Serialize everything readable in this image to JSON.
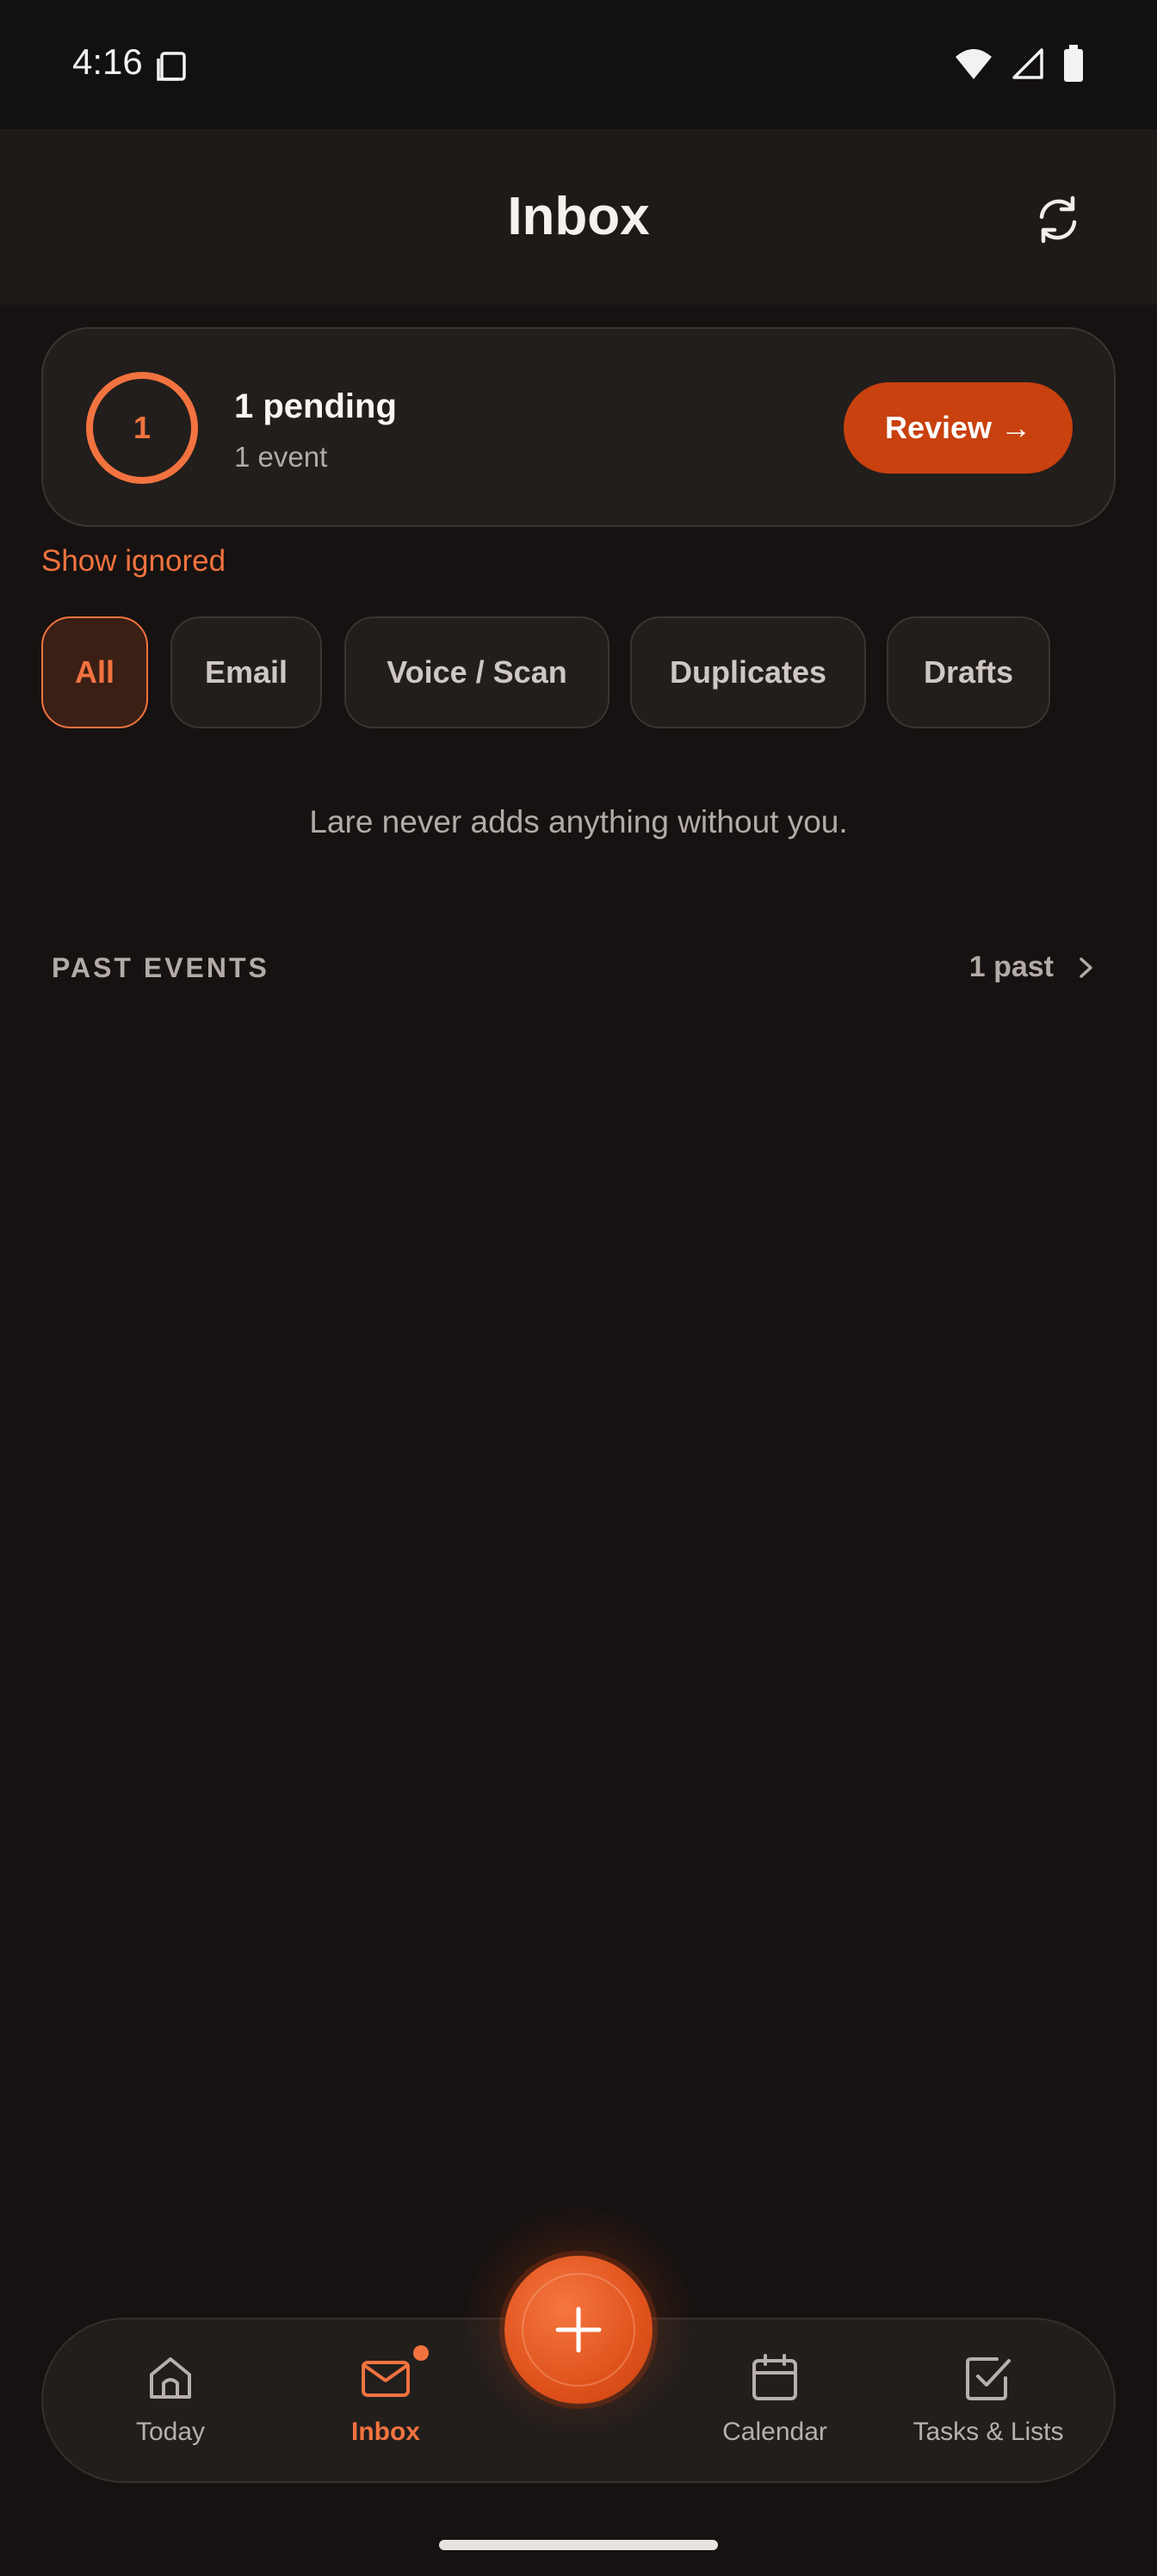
{
  "status_bar": {
    "time": "4:16"
  },
  "header": {
    "title": "Inbox"
  },
  "pending": {
    "count": "1",
    "title": "1 pending",
    "subtitle": "1 event",
    "review_label": "Review →"
  },
  "show_ignored_label": "Show ignored",
  "filters": [
    {
      "label": "All",
      "selected": true
    },
    {
      "label": "Email",
      "selected": false
    },
    {
      "label": "Voice / Scan",
      "selected": false
    },
    {
      "label": "Duplicates",
      "selected": false
    },
    {
      "label": "Drafts",
      "selected": false
    }
  ],
  "notice": "Lare never adds anything without you.",
  "past_events": {
    "label": "PAST EVENTS",
    "count_label": "1 past"
  },
  "nav": {
    "items": [
      {
        "label": "Today",
        "icon": "home-icon"
      },
      {
        "label": "Inbox",
        "icon": "mail-icon",
        "active": true,
        "badge": true
      },
      {
        "label": "Calendar",
        "icon": "calendar-icon"
      },
      {
        "label": "Tasks & Lists",
        "icon": "checkbox-icon"
      }
    ],
    "fab_icon": "plus-icon"
  },
  "colors": {
    "accent": "#f2733f",
    "button": "#c8410e",
    "background": "#161211",
    "card": "#221e1c"
  }
}
